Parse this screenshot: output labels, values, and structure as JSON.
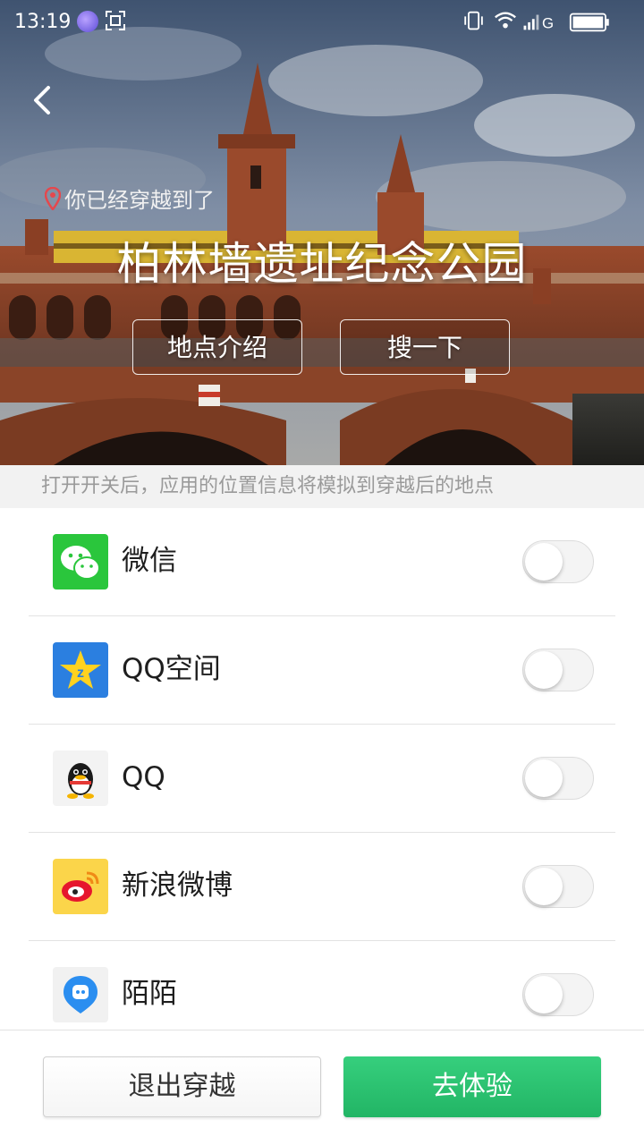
{
  "status_bar": {
    "time": "13:19",
    "carrier_label": "G",
    "icons": [
      "avatar-icon",
      "screenshot-icon",
      "vibrate-icon",
      "wifi-icon",
      "signal-icon",
      "battery-icon"
    ]
  },
  "hero": {
    "back_icon": "chevron-left-icon",
    "location_prefix": "你已经穿越到了",
    "place_name": "柏林墙遗址纪念公园",
    "intro_button": "地点介绍",
    "search_button": "搜一下"
  },
  "hint": "打开开关后，应用的位置信息将模拟到穿越后的地点",
  "apps": [
    {
      "name": "微信",
      "icon": "wechat-icon",
      "enabled": false
    },
    {
      "name": "QQ空间",
      "icon": "qzone-icon",
      "enabled": false
    },
    {
      "name": "QQ",
      "icon": "qq-icon",
      "enabled": false
    },
    {
      "name": "新浪微博",
      "icon": "weibo-icon",
      "enabled": false
    },
    {
      "name": "陌陌",
      "icon": "momo-icon",
      "enabled": false
    }
  ],
  "bottom": {
    "exit_label": "退出穿越",
    "go_label": "去体验"
  },
  "colors": {
    "accent_green": "#22b565",
    "hint_bg": "#f2f2f2",
    "pin_red": "#e5484d"
  }
}
